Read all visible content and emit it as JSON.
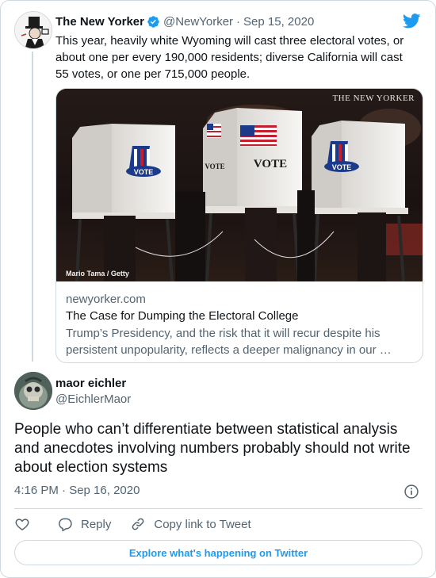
{
  "colors": {
    "accent": "#1d9bf0",
    "text_primary": "#0f1419",
    "text_secondary": "#536471",
    "border": "#cfd9de"
  },
  "icons": {
    "brand": "twitter-bird-icon",
    "verified": "verified-badge-icon",
    "info": "info-icon",
    "like": "heart-icon",
    "reply": "reply-bubble-icon",
    "copy_link": "link-icon"
  },
  "parent_tweet": {
    "display_name": "The New Yorker",
    "handle": "@NewYorker",
    "separator": "·",
    "date": "Sep 15, 2020",
    "text": "This year, heavily white Wyoming will cast three electoral votes, or about one per every 190,000 residents; diverse California will cast 55 votes, or one per 715,000 people.",
    "link_card": {
      "image_watermark": "THE NEW YORKER",
      "image_credit": "Mario Tama / Getty",
      "booth_signs": [
        "VOTE",
        "VOTE",
        "VOTE",
        "VOTE"
      ],
      "domain": "newyorker.com",
      "title": "The Case for Dumping the Electoral College",
      "description_line1": "Trump’s Presidency, and the risk that it will recur despite his",
      "description_line2": "persistent unpopularity, reflects a deeper malignancy in our …"
    }
  },
  "main_tweet": {
    "display_name": "maor eichler",
    "handle": "@EichlerMaor",
    "text": "People who can’t differentiate between statistical analysis and anecdotes involving numbers probably should not write about election systems",
    "timestamp": "4:16 PM · Sep 16, 2020"
  },
  "actions": {
    "reply_label": "Reply",
    "copy_link_label": "Copy link to Tweet"
  },
  "explore_label": "Explore what's happening on Twitter"
}
